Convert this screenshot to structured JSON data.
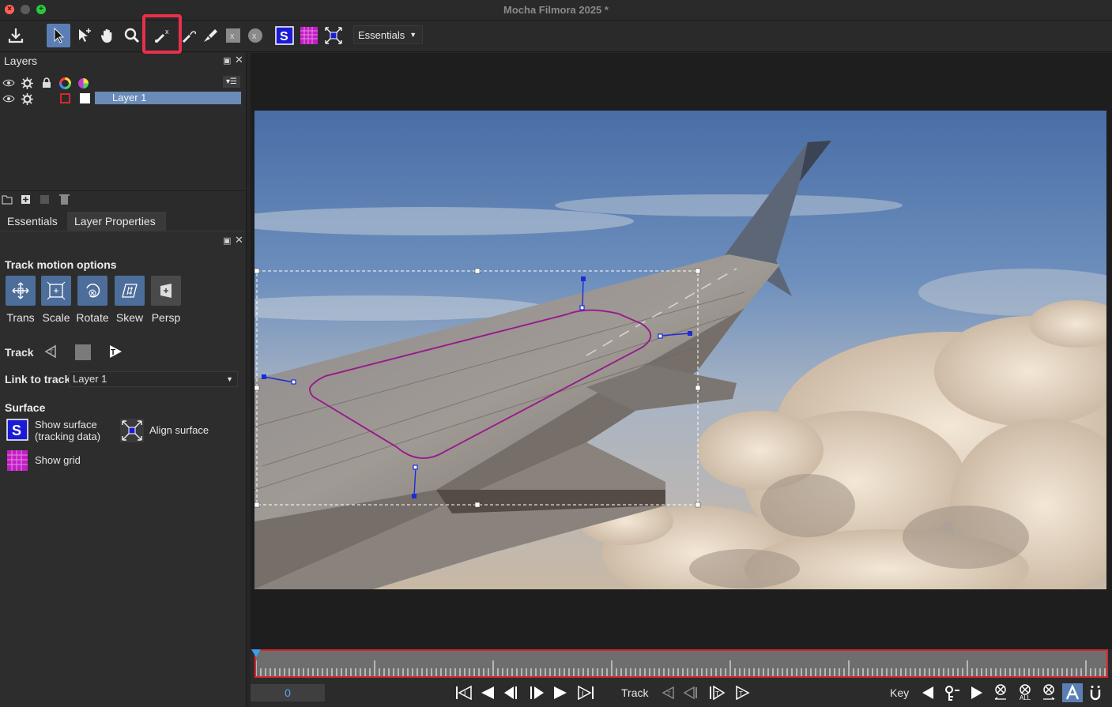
{
  "window": {
    "title": "Mocha Filmora 2025 *"
  },
  "toolbar": {
    "icons": [
      "export-icon",
      "select-tool-icon",
      "add-point-tool-icon",
      "pan-tool-icon",
      "zoom-tool-icon",
      "create-xspline-icon",
      "create-bezier-icon",
      "brush-icon",
      "clear-icon",
      "x-circle-icon",
      "show-surface-icon",
      "show-grid-icon",
      "align-surface-icon"
    ],
    "workspace": {
      "label": "Essentials"
    }
  },
  "layers_panel": {
    "title": "Layers",
    "layers": [
      {
        "name": "Layer 1",
        "color": "#d22a2a"
      }
    ]
  },
  "tabs": [
    {
      "label": "Essentials"
    },
    {
      "label": "Layer Properties",
      "selected": true
    }
  ],
  "properties": {
    "track_motion_title": "Track motion options",
    "motion_options": [
      {
        "label": "Trans",
        "enabled": true
      },
      {
        "label": "Scale",
        "enabled": true
      },
      {
        "label": "Rotate",
        "enabled": true
      },
      {
        "label": "Skew",
        "enabled": true
      },
      {
        "label": "Persp",
        "enabled": false
      }
    ],
    "track_label": "Track",
    "link_to_track_label": "Link to track",
    "link_to_track_value": "Layer 1",
    "surface_title": "Surface",
    "show_surface_label": "Show surface (tracking data)",
    "show_surface_line1": "Show surface",
    "show_surface_line2": "(tracking data)",
    "align_surface_label": "Align surface",
    "show_grid_label": "Show grid"
  },
  "timeline": {
    "frame": "0",
    "track_label": "Track",
    "key_label": "Key",
    "all_label": "ALL"
  },
  "colors": {
    "accent": "#5b7fb4",
    "highlight": "#e8304a",
    "spline": "#d1196b",
    "timeline_border": "#d8262c"
  }
}
